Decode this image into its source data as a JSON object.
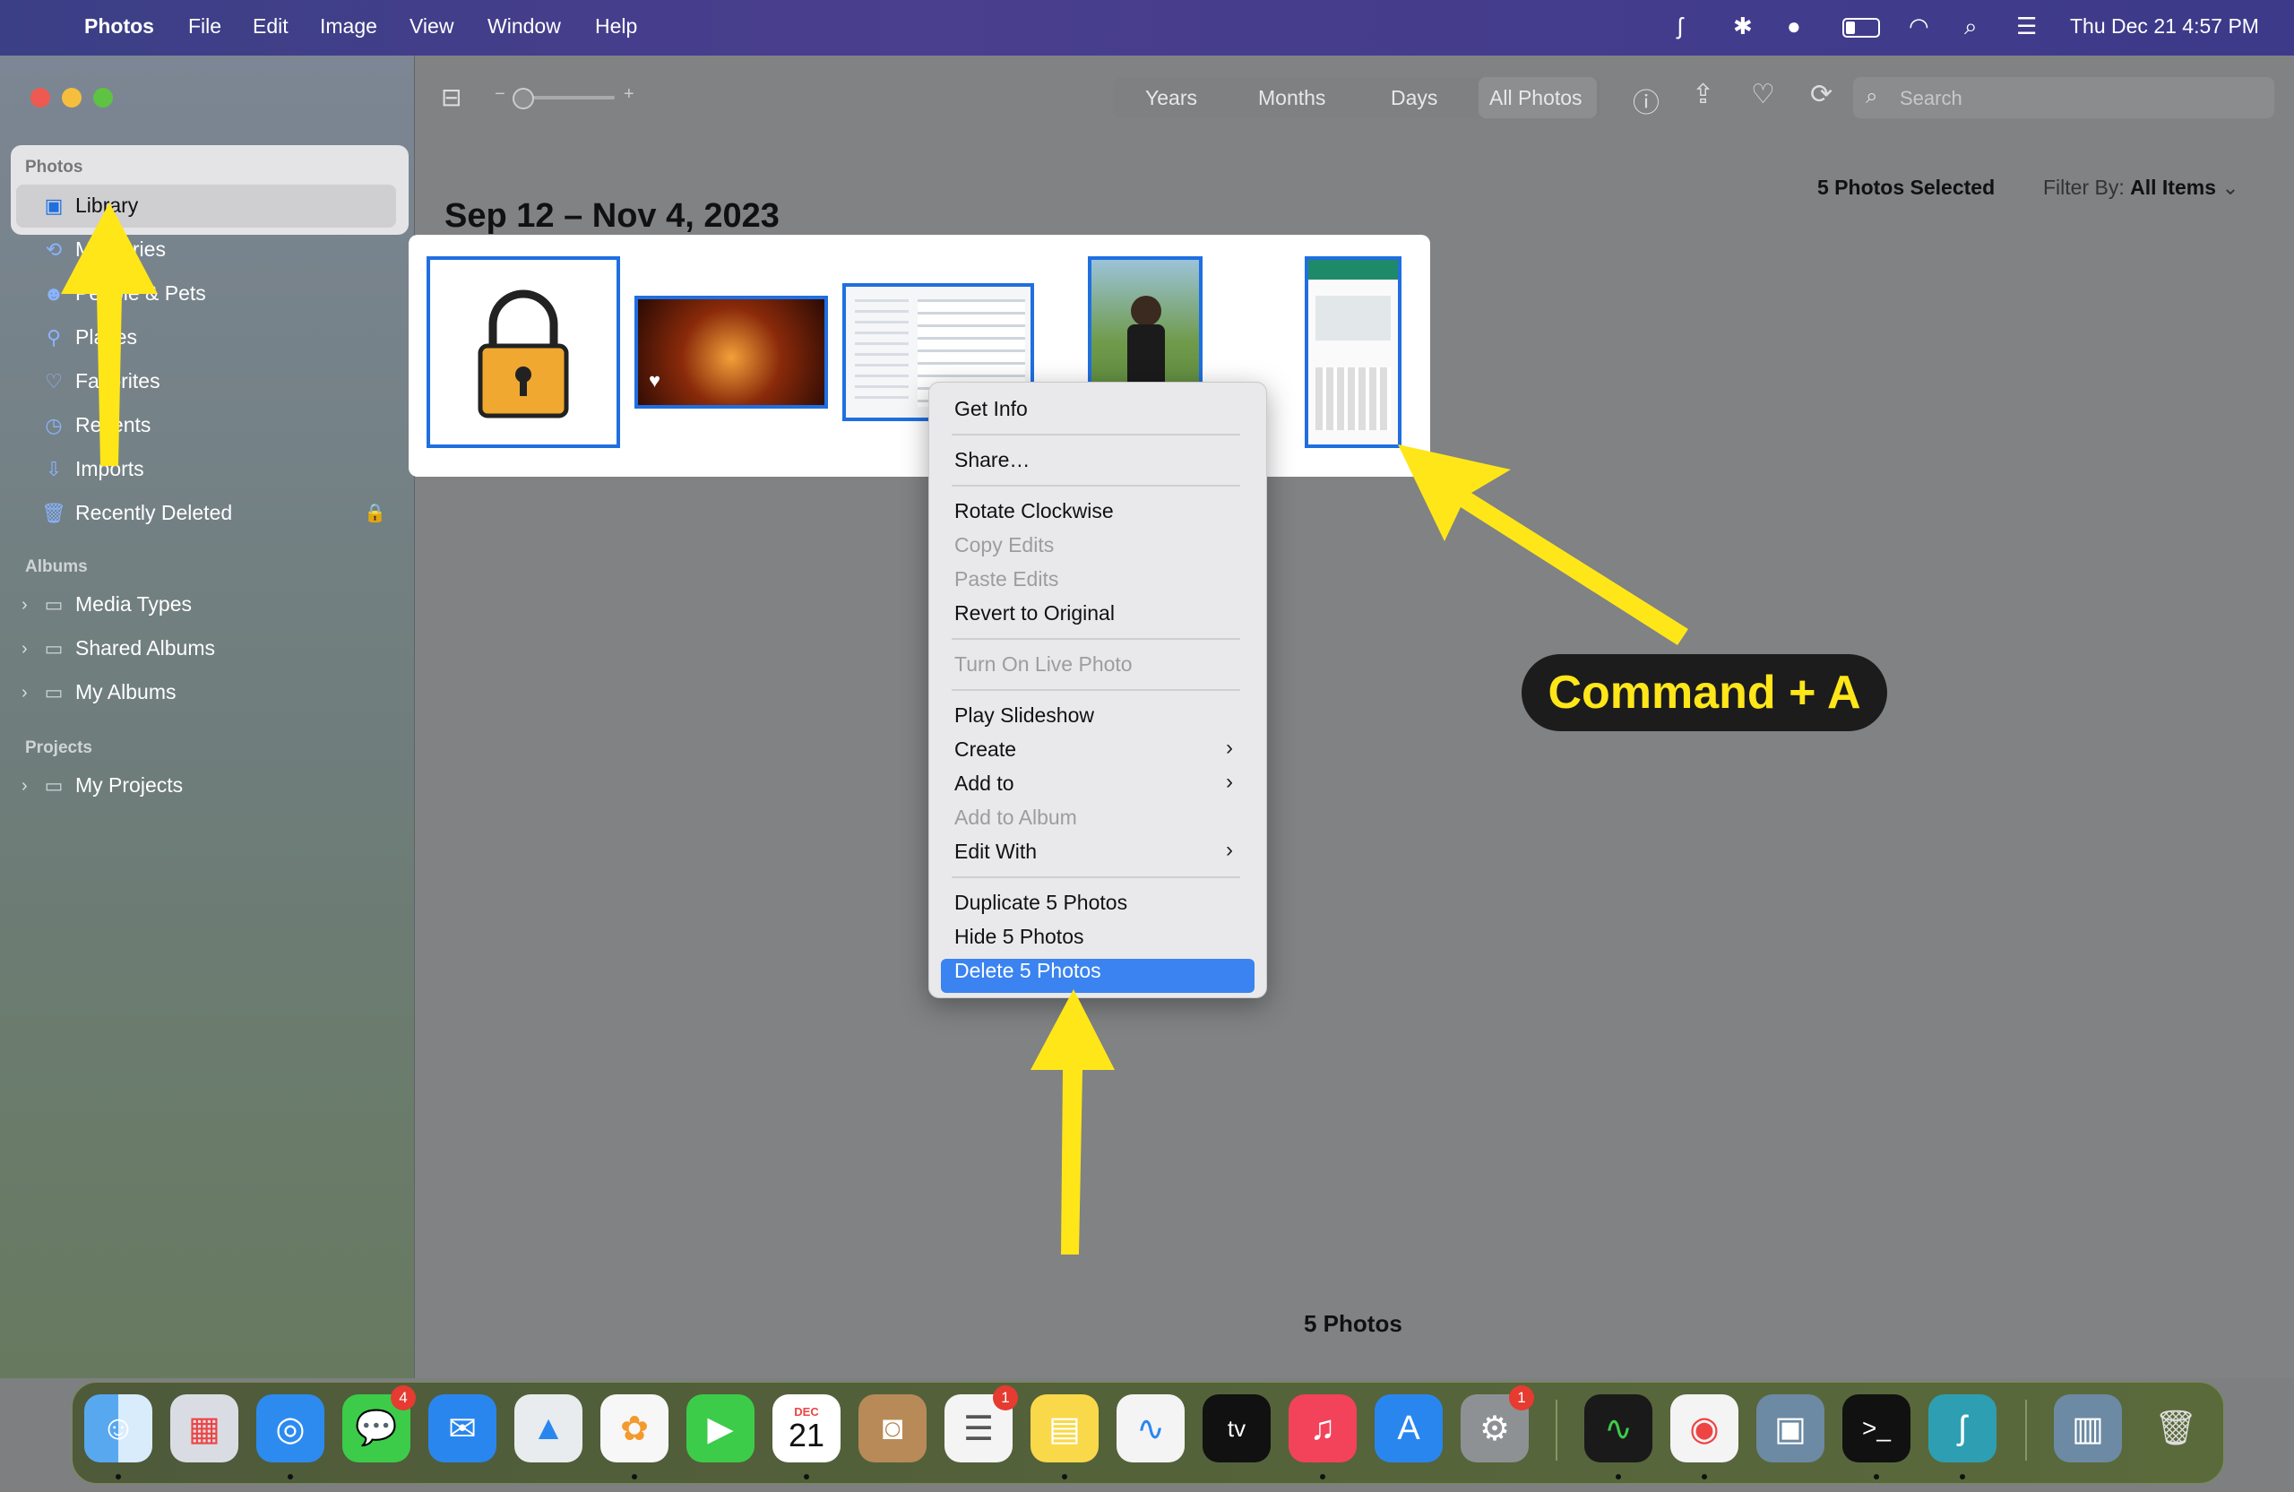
{
  "menubar": {
    "app": "Photos",
    "items": [
      "File",
      "Edit",
      "Image",
      "View",
      "Window",
      "Help"
    ],
    "clock": "Thu Dec 21  4:57 PM"
  },
  "sidebar": {
    "photos_header": "Photos",
    "items": [
      "Library",
      "Memories",
      "People & Pets",
      "Places",
      "Favorites",
      "Recents",
      "Imports",
      "Recently Deleted"
    ],
    "albums_header": "Albums",
    "albums": [
      "Media Types",
      "Shared Albums",
      "My Albums"
    ],
    "projects_header": "Projects",
    "projects": [
      "My Projects"
    ]
  },
  "toolbar": {
    "views": [
      "Years",
      "Months",
      "Days",
      "All Photos"
    ],
    "selected_view": "All Photos",
    "search_placeholder": "Search"
  },
  "content": {
    "date_range": "Sep 12 – Nov 4, 2023",
    "selected": "5 Photos Selected",
    "filter_label": "Filter By:",
    "filter_value": "All Items",
    "footer": "5 Photos"
  },
  "context_menu": {
    "items": [
      {
        "label": "Get Info",
        "enabled": true
      },
      {
        "label": "Share…",
        "enabled": true
      },
      {
        "label": "Rotate Clockwise",
        "enabled": true
      },
      {
        "label": "Copy Edits",
        "enabled": false
      },
      {
        "label": "Paste Edits",
        "enabled": false
      },
      {
        "label": "Revert to Original",
        "enabled": true
      },
      {
        "label": "Turn On Live Photo",
        "enabled": false
      },
      {
        "label": "Play Slideshow",
        "enabled": true
      },
      {
        "label": "Create",
        "enabled": true,
        "submenu": true
      },
      {
        "label": "Add to",
        "enabled": true,
        "submenu": true
      },
      {
        "label": "Add to Album",
        "enabled": false
      },
      {
        "label": "Edit With",
        "enabled": true,
        "submenu": true
      },
      {
        "label": "Duplicate 5 Photos",
        "enabled": true
      },
      {
        "label": "Hide 5 Photos",
        "enabled": true
      },
      {
        "label": "Delete 5 Photos",
        "enabled": true,
        "highlighted": true
      }
    ]
  },
  "annotation": {
    "label": "Command + A"
  },
  "dock": {
    "badges": {
      "messages": "4",
      "reminders": "1",
      "settings": "1"
    },
    "calendar_month": "DEC",
    "calendar_day": "21"
  },
  "colors": {
    "accent": "#3a83f1",
    "selection_border": "#1f6fe0",
    "annotation_yellow": "#ffe619"
  }
}
